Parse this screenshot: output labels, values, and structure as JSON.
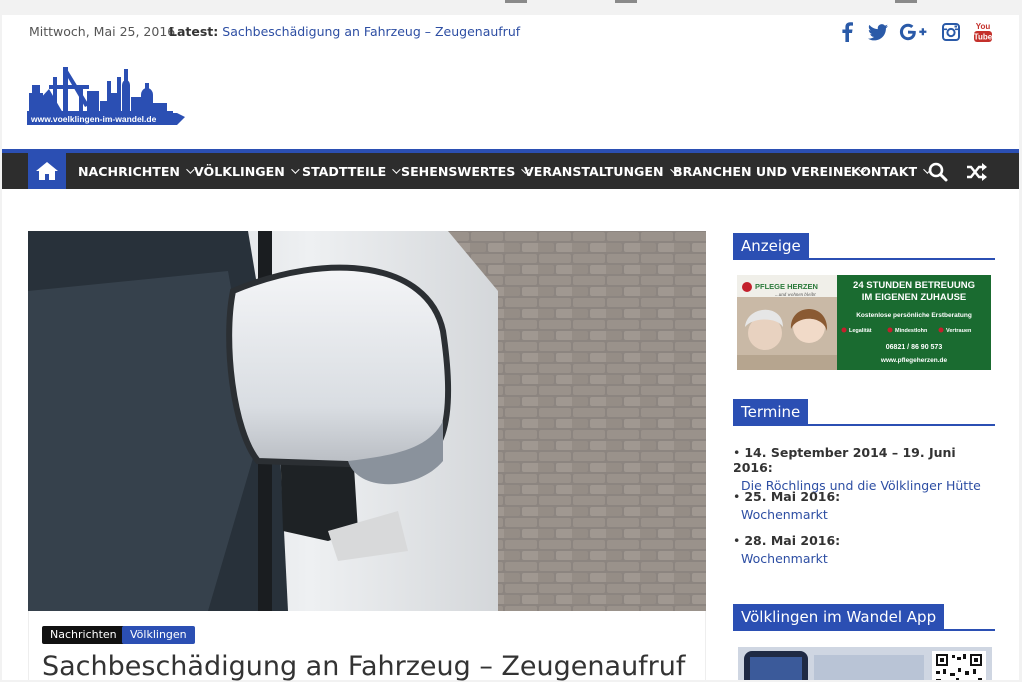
{
  "header": {
    "date": "Mittwoch, Mai 25, 2016",
    "latest_label": "Latest:",
    "latest_link": "Sachbeschädigung an Fahrzeug – Zeugenaufruf",
    "social_icons": [
      "facebook-icon",
      "twitter-icon",
      "google-plus-icon",
      "instagram-icon",
      "youtube-icon"
    ],
    "youtube_text": "You Tube"
  },
  "logo": {
    "text": "www.voelklingen-im-wandel.de"
  },
  "nav": {
    "items": [
      {
        "label": "NACHRICHTEN"
      },
      {
        "label": "VÖLKLINGEN"
      },
      {
        "label": "STADTTEILE"
      },
      {
        "label": "SEHENSWERTES"
      },
      {
        "label": "VERANSTALTUNGEN"
      },
      {
        "label": "BRANCHEN UND VEREINE"
      },
      {
        "label": "KONTAKT"
      }
    ]
  },
  "post": {
    "categories": [
      "Nachrichten",
      "Völklingen"
    ],
    "title": "Sachbeschädigung an Fahrzeug – Zeugenaufruf"
  },
  "sidebar": {
    "ad_title": "Anzeige",
    "ad": {
      "brand": "PFLEGE HERZEN",
      "tagline": "...und wohnen bleibt",
      "headline_1": "24 STUNDEN BETREUUNG",
      "headline_2": "IM EIGENEN ZUHAUSE",
      "sub": "Kostenlose persönliche Erstberatung",
      "bullets": [
        "Legalität",
        "Mindestlohn",
        "Vertrauen"
      ],
      "phone": "06821 / 86 90 573",
      "url": "www.pflegeherzen.de"
    },
    "termine_title": "Termine",
    "events": [
      {
        "date": "14. September 2014 – 19. Juni 2016:",
        "title": "Die Röchlings und die Völklinger Hütte"
      },
      {
        "date": "25. Mai 2016:",
        "title": "Wochenmarkt"
      },
      {
        "date": "28. Mai 2016:",
        "title": "Wochenmarkt"
      }
    ],
    "app_title": "Völklingen im Wandel App"
  },
  "colors": {
    "accent": "#2b4fb3",
    "nav_bg": "#2d2d2d",
    "link": "#2d4ea3"
  }
}
